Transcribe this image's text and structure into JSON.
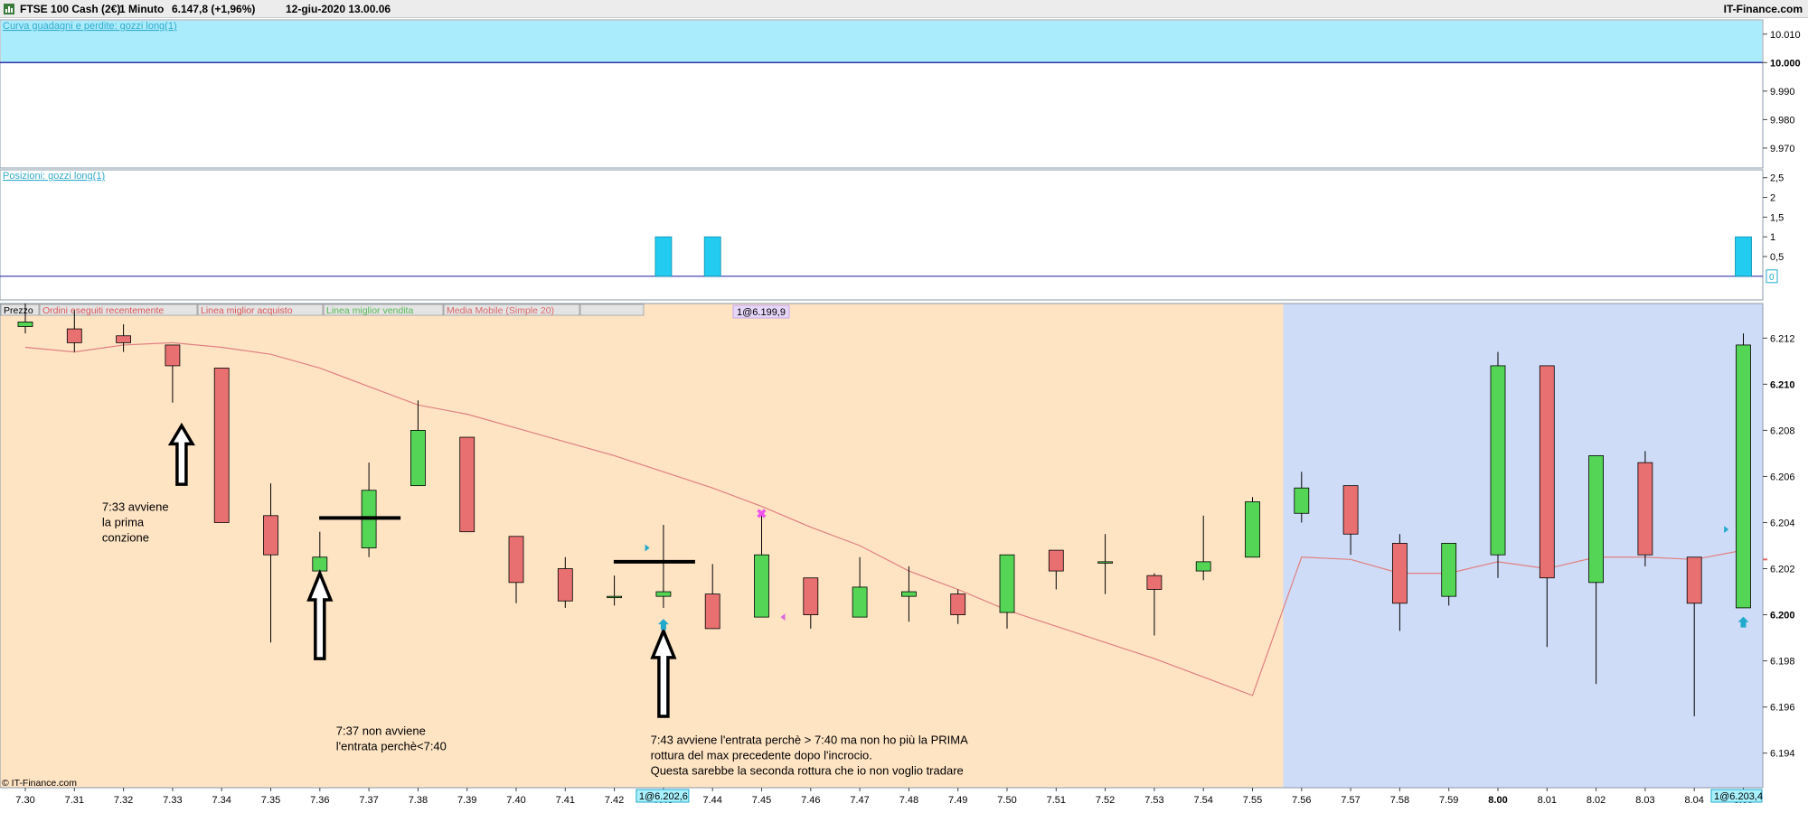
{
  "window": {
    "instrument": "FTSE 100 Cash (2€)",
    "timeframe": "1 Minuto",
    "last_price": "6.147,8 (+1,96%)",
    "datetime": "12-giu-2020 13.00.06",
    "brand": "IT-Finance.com",
    "watermark": "© IT-Finance.com"
  },
  "colors": {
    "bull": "#55d555",
    "bear": "#e87070",
    "moving_average": "#e08080",
    "session_bg": "#ffe4c4",
    "after_session_bg": "#cfdcf8",
    "equity_bg": "#aaecfc",
    "position_bar": "#22ccf0",
    "level_line": "#3333aa"
  },
  "equity_panel": {
    "label": "Curva guadagni e perdite: gozzi long(1)",
    "ticks": [
      "10.010",
      "10.000",
      "9.990",
      "9.980",
      "9.970"
    ],
    "tick_values": [
      10010,
      10000,
      9990,
      9980,
      9970
    ],
    "ylim": [
      9963,
      10015
    ],
    "level": 10000,
    "level_label": "10.000"
  },
  "position_panel": {
    "label": "Posizioni: gozzi long(1)",
    "ticks": [
      "2,5",
      "2",
      "1,5",
      "1",
      "0,5"
    ],
    "tick_values": [
      2.5,
      2,
      1.5,
      1,
      0.5
    ],
    "ylim": [
      -0.6,
      2.7
    ],
    "current_label": "0",
    "bars": [
      {
        "x": "7.43",
        "value": 1
      },
      {
        "x": "7.44",
        "value": 1
      },
      {
        "x": "8.05",
        "value": 1
      }
    ]
  },
  "price_panel": {
    "legend": [
      "Prezzo",
      "Ordini eseguiti recentemente",
      "Linea miglior acquisto",
      "Linea miglior vendita",
      "Media Mobile (Simple 20)"
    ],
    "trade_labels": [
      "1@6.199,9",
      "1@6.202,6",
      "1@6.203,4"
    ],
    "current_price_marker": 6.2024
  },
  "chart_data": {
    "type": "candlestick",
    "x": [
      "7.30",
      "7.31",
      "7.32",
      "7.33",
      "7.34",
      "7.35",
      "7.36",
      "7.37",
      "7.38",
      "7.39",
      "7.40",
      "7.41",
      "7.42",
      "7.43",
      "7.44",
      "7.45",
      "7.46",
      "7.47",
      "7.48",
      "7.49",
      "7.50",
      "7.51",
      "7.52",
      "7.53",
      "7.54",
      "7.55",
      "7.56",
      "7.57",
      "7.58",
      "7.59",
      "8.00",
      "8.01",
      "8.02",
      "8.03",
      "8.04",
      "8.05"
    ],
    "x_bold": "8.00",
    "ohlc": [
      [
        6.2125,
        6.2135,
        6.2122,
        6.2127
      ],
      [
        6.2124,
        6.2132,
        6.2114,
        6.2118
      ],
      [
        6.2121,
        6.2126,
        6.2114,
        6.2118
      ],
      [
        6.2117,
        6.2117,
        6.2092,
        6.2108
      ],
      [
        6.2107,
        6.2107,
        6.204,
        6.204
      ],
      [
        6.2043,
        6.2057,
        6.1988,
        6.2026
      ],
      [
        6.2019,
        6.2036,
        6.2013,
        6.2025
      ],
      [
        6.2029,
        6.2066,
        6.2025,
        6.2054
      ],
      [
        6.2056,
        6.2093,
        6.2056,
        6.208
      ],
      [
        6.2077,
        6.2077,
        6.2036,
        6.2036
      ],
      [
        6.2034,
        6.2034,
        6.2005,
        6.2014
      ],
      [
        6.202,
        6.2025,
        6.2003,
        6.2006
      ],
      [
        6.2008,
        6.2017,
        6.2004,
        6.2008
      ],
      [
        6.2008,
        6.2039,
        6.2003,
        6.201
      ],
      [
        6.2009,
        6.2022,
        6.1994,
        6.1994
      ],
      [
        6.1999,
        6.2043,
        6.1999,
        6.2026
      ],
      [
        6.2016,
        6.2016,
        6.1994,
        6.2
      ],
      [
        6.1999,
        6.2025,
        6.1999,
        6.2012
      ],
      [
        6.2008,
        6.2021,
        6.1997,
        6.201
      ],
      [
        6.2009,
        6.2011,
        6.1996,
        6.2
      ],
      [
        6.2001,
        6.2026,
        6.1994,
        6.2026
      ],
      [
        6.2028,
        6.2028,
        6.2011,
        6.2019
      ],
      [
        6.2023,
        6.2035,
        6.2009,
        6.2023
      ],
      [
        6.2017,
        6.2018,
        6.1991,
        6.2011
      ],
      [
        6.2019,
        6.2043,
        6.2015,
        6.2023
      ],
      [
        6.2025,
        6.2051,
        6.2025,
        6.2049
      ],
      [
        6.2044,
        6.2062,
        6.204,
        6.2055
      ],
      [
        6.2056,
        6.2056,
        6.2026,
        6.2035
      ],
      [
        6.2031,
        6.2035,
        6.1993,
        6.2005
      ],
      [
        6.2008,
        6.2031,
        6.2004,
        6.2031
      ],
      [
        6.2026,
        6.2114,
        6.2016,
        6.2108
      ],
      [
        6.2108,
        6.2108,
        6.1986,
        6.2016
      ],
      [
        6.2014,
        6.2069,
        6.197,
        6.2069
      ],
      [
        6.2066,
        6.2071,
        6.2021,
        6.2026
      ],
      [
        6.2025,
        6.2025,
        6.1956,
        6.2005
      ],
      [
        6.2003,
        6.2122,
        6.2003,
        6.2117
      ]
    ],
    "moving_average": [
      6.2116,
      6.2114,
      6.2117,
      6.2118,
      6.2116,
      6.2113,
      6.2107,
      6.2099,
      6.2091,
      6.2087,
      6.2081,
      6.2075,
      6.2069,
      6.2062,
      6.2055,
      6.2047,
      6.2038,
      6.203,
      6.2019,
      6.2011,
      6.2002,
      6.1995,
      6.1988,
      6.1981,
      6.1973,
      6.1965,
      6.2025,
      6.2024,
      6.2018,
      6.2018,
      6.2023,
      6.202,
      6.2025,
      6.2025,
      6.2024,
      6.2028
    ],
    "yticks": [
      "6.212",
      "6.210",
      "6.208",
      "6.206",
      "6.204",
      "6.202",
      "6.200",
      "6.198",
      "6.196",
      "6.194"
    ],
    "ytick_values": [
      6.212,
      6.21,
      6.208,
      6.206,
      6.204,
      6.202,
      6.2,
      6.198,
      6.196,
      6.194
    ],
    "ytick_bold": [
      "6.210",
      "6.200"
    ],
    "ylim": [
      6.1925,
      6.2135
    ],
    "session_end_x": "7.55",
    "annotations": [
      {
        "lines": [
          "7:33 avviene",
          "la prima",
          "conzione"
        ],
        "x": "7.33",
        "y": 6.2045
      },
      {
        "lines": [
          "7:37 non avviene",
          "l'entrata perchè<7:40"
        ],
        "x": "7.36",
        "y": 6.1948
      },
      {
        "lines": [
          "7:43 avviene l'entrata perchè > 7:40 ma non ho più la PRIMA",
          "rottura del max precedente dopo l'incrocio.",
          "Questa sarebbe la seconda rottura che io non voglio tradare"
        ],
        "x": "7.42",
        "y": 6.1944
      }
    ],
    "break_lines": [
      {
        "x": "7.37",
        "y": 6.2042
      },
      {
        "x": "7.43",
        "y": 6.2023
      }
    ],
    "arrows": [
      {
        "x": "7.33",
        "y_top": 6.2082
      },
      {
        "x": "7.36",
        "y_top": 6.2018
      },
      {
        "x": "7.43",
        "y_top": 6.1993
      }
    ]
  }
}
